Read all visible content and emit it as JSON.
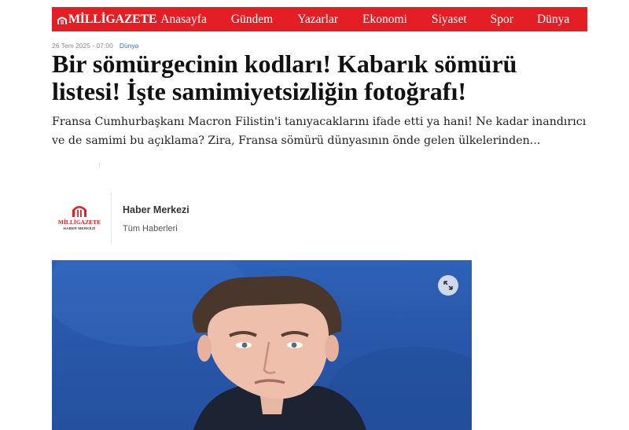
{
  "nav": {
    "logo": "MİLLİGAZETE",
    "items": [
      "Anasayfa",
      "Gündem",
      "Yazarlar",
      "Ekonomi",
      "Siyaset",
      "Spor",
      "Dünya"
    ]
  },
  "article": {
    "date": "26 Tem 2025 - 07:00",
    "category": "Dünya",
    "title_line1": "Bir sömürgecinin kodları! Kabarık sömürü",
    "title_line2": "listesi! İşte samimiyetsizliğin fotoğrafı!",
    "summary": "Fransa Cumhurbaşkanı Macron Filistin'i tanıyacaklarını ifade etti ya hani! Ne kadar inandırıcı ve de samimi bu açıklama? Zira, Fransa sömürü dünyasının önde gelen ülkelerinden..."
  },
  "author": {
    "logo_text": "MİLLİGAZETE",
    "logo_sub": "HABER MERKEZİ",
    "name": "Haber Merkezi",
    "link": "Tüm Haberleri"
  },
  "icons": {
    "expand": "expand-icon",
    "logo": "milligazete-logo-icon"
  },
  "colors": {
    "brand": "#e31e24",
    "category": "#3b6fd6",
    "photo_background": "#2a58aa"
  }
}
